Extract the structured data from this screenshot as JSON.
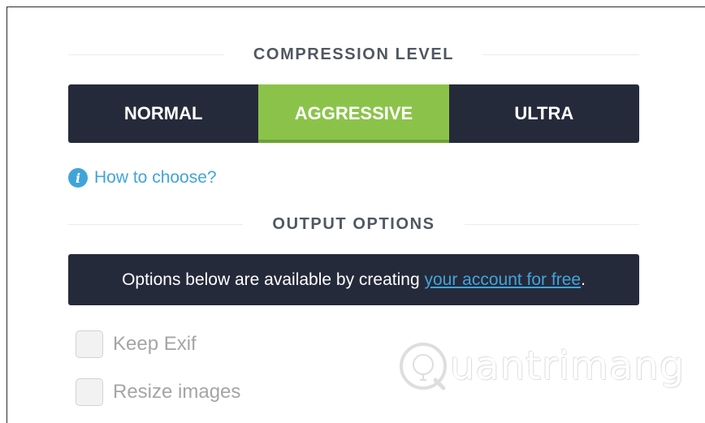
{
  "compression": {
    "heading": "COMPRESSION LEVEL",
    "levels": [
      {
        "label": "NORMAL",
        "active": false
      },
      {
        "label": "AGGRESSIVE",
        "active": true
      },
      {
        "label": "ULTRA",
        "active": false
      }
    ],
    "help_link": "How to choose?",
    "help_icon": "info-icon"
  },
  "output": {
    "heading": "OUTPUT OPTIONS",
    "notice_text": "Options below are available by creating ",
    "notice_link": "your account for free",
    "notice_end": ".",
    "options": [
      {
        "label": "Keep Exif",
        "checked": false,
        "disabled": true
      },
      {
        "label": "Resize images",
        "checked": false,
        "disabled": true
      }
    ]
  },
  "watermark": {
    "text": "uantrimang"
  },
  "colors": {
    "dark": "#252a3b",
    "accent_green": "#8bc34a",
    "link_blue": "#41a4d9",
    "heading_gray": "#505762"
  }
}
